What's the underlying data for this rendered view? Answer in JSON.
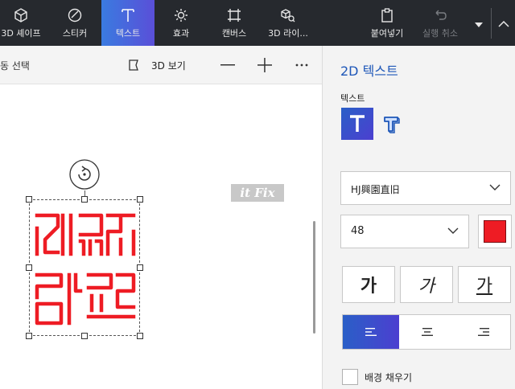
{
  "toolbar": {
    "tools": [
      {
        "label": "3D 셰이프",
        "icon": "cube-icon"
      },
      {
        "label": "스티커",
        "icon": "sticker-icon"
      },
      {
        "label": "텍스트",
        "icon": "text-icon"
      },
      {
        "label": "효과",
        "icon": "sun-icon"
      },
      {
        "label": "캔버스",
        "icon": "canvas-icon"
      },
      {
        "label": "3D 라이...",
        "icon": "library-icon"
      },
      {
        "label": "붙여넣기",
        "icon": "paste-icon"
      },
      {
        "label": "실행 취소",
        "icon": "undo-icon"
      }
    ],
    "active_tool": "텍스트"
  },
  "subbar": {
    "select_label": "동 선택",
    "view3d_label": "3D 보기"
  },
  "watermark": {
    "text": "it Fix"
  },
  "panel": {
    "title": "2D 텍스트",
    "text_label": "텍스트",
    "font_value": "HJ興園直旧",
    "size_value": "48",
    "text_color": "#ee1c24",
    "style_bold": "가",
    "style_italic": "가",
    "style_underline": "가",
    "background_fill_label": "배경 채우기"
  },
  "colors": {
    "accent": "#3a7be0",
    "toolbar_bg": "#26292e",
    "text_art": "#ee1c24"
  }
}
